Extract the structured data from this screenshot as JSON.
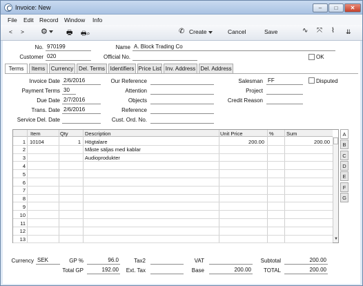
{
  "window": {
    "title": "Invoice: New"
  },
  "menu": [
    "File",
    "Edit",
    "Record",
    "Window",
    "Info"
  ],
  "toolbar": {
    "create": "Create",
    "cancel": "Cancel",
    "save": "Save"
  },
  "header": {
    "no_label": "No.",
    "no_value": "970199",
    "name_label": "Name",
    "name_value": "A. Block Trading Co",
    "customer_label": "Customer",
    "customer_value": "020",
    "official_label": "Official No.",
    "official_value": "",
    "ok_label": "OK"
  },
  "tabs": [
    "Terms",
    "Items",
    "Currency",
    "Del. Terms",
    "Identifiers",
    "Price List",
    "Inv. Address",
    "Del. Address"
  ],
  "terms": {
    "invoice_date_label": "Invoice Date",
    "invoice_date": "2/6/2016",
    "our_ref_label": "Our Reference",
    "our_ref": "",
    "salesman_label": "Salesman",
    "salesman": "FF",
    "disputed_label": "Disputed",
    "payment_terms_label": "Payment Terms",
    "payment_terms": "30",
    "attention_label": "Attention",
    "attention": "",
    "project_label": "Project",
    "project": "",
    "due_date_label": "Due Date",
    "due_date": "2/7/2016",
    "objects_label": "Objects",
    "objects": "",
    "credit_reason_label": "Credit Reason",
    "credit_reason": "",
    "trans_date_label": "Trans. Date",
    "trans_date": "2/6/2016",
    "reference_label": "Reference",
    "reference": "",
    "service_del_label": "Service Del. Date",
    "service_del": "",
    "cust_ord_label": "Cust. Ord. No.",
    "cust_ord": ""
  },
  "grid": {
    "columns": [
      "Item",
      "Qty",
      "Description",
      "Unit Price",
      "%",
      "Sum"
    ],
    "rows": [
      {
        "n": "1",
        "item": "10104",
        "qty": "1",
        "desc": "Högtalare",
        "price": "200.00",
        "pct": "",
        "sum": "200.00"
      },
      {
        "n": "2",
        "item": "",
        "qty": "",
        "desc": "Måste säljas med kablar",
        "price": "",
        "pct": "",
        "sum": ""
      },
      {
        "n": "3",
        "item": "",
        "qty": "",
        "desc": "Audioprodukter",
        "price": "",
        "pct": "",
        "sum": ""
      },
      {
        "n": "4",
        "item": "",
        "qty": "",
        "desc": "",
        "price": "",
        "pct": "",
        "sum": ""
      },
      {
        "n": "5",
        "item": "",
        "qty": "",
        "desc": "",
        "price": "",
        "pct": "",
        "sum": ""
      },
      {
        "n": "6",
        "item": "",
        "qty": "",
        "desc": "",
        "price": "",
        "pct": "",
        "sum": ""
      },
      {
        "n": "7",
        "item": "",
        "qty": "",
        "desc": "",
        "price": "",
        "pct": "",
        "sum": ""
      },
      {
        "n": "8",
        "item": "",
        "qty": "",
        "desc": "",
        "price": "",
        "pct": "",
        "sum": ""
      },
      {
        "n": "9",
        "item": "",
        "qty": "",
        "desc": "",
        "price": "",
        "pct": "",
        "sum": ""
      },
      {
        "n": "10",
        "item": "",
        "qty": "",
        "desc": "",
        "price": "",
        "pct": "",
        "sum": ""
      },
      {
        "n": "11",
        "item": "",
        "qty": "",
        "desc": "",
        "price": "",
        "pct": "",
        "sum": ""
      },
      {
        "n": "12",
        "item": "",
        "qty": "",
        "desc": "",
        "price": "",
        "pct": "",
        "sum": ""
      },
      {
        "n": "13",
        "item": "",
        "qty": "",
        "desc": "",
        "price": "",
        "pct": "",
        "sum": ""
      }
    ]
  },
  "side_tabs": [
    "A",
    "B",
    "C",
    "D",
    "E",
    "F",
    "G"
  ],
  "footer": {
    "currency_label": "Currency",
    "currency": "SEK",
    "gp_pct_label": "GP %",
    "gp_pct": "96.0",
    "tax2_label": "Tax2",
    "tax2": "",
    "vat_label": "VAT",
    "vat": "",
    "subtotal_label": "Subtotal",
    "subtotal": "200.00",
    "total_gp_label": "Total GP",
    "total_gp": "192.00",
    "ext_tax_label": "Ext. Tax",
    "ext_tax": "",
    "base_label": "Base",
    "base": "200.00",
    "total_label": "TOTAL",
    "total": "200.00"
  }
}
